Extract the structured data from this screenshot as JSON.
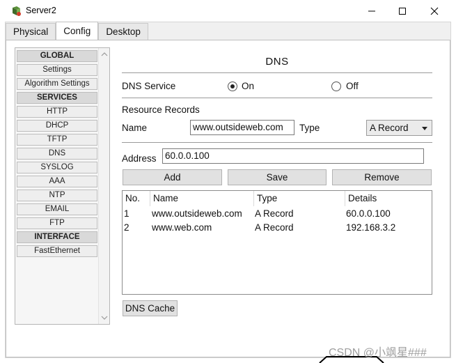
{
  "window": {
    "title": "Server2"
  },
  "tabs": [
    {
      "label": "Physical",
      "active": false
    },
    {
      "label": "Config",
      "active": true
    },
    {
      "label": "Desktop",
      "active": false
    }
  ],
  "sidebar": {
    "items": [
      {
        "label": "GLOBAL",
        "header": true
      },
      {
        "label": "Settings",
        "header": false
      },
      {
        "label": "Algorithm Settings",
        "header": false
      },
      {
        "label": "SERVICES",
        "header": true
      },
      {
        "label": "HTTP",
        "header": false
      },
      {
        "label": "DHCP",
        "header": false
      },
      {
        "label": "TFTP",
        "header": false
      },
      {
        "label": "DNS",
        "header": false
      },
      {
        "label": "SYSLOG",
        "header": false
      },
      {
        "label": "AAA",
        "header": false
      },
      {
        "label": "NTP",
        "header": false
      },
      {
        "label": "EMAIL",
        "header": false
      },
      {
        "label": "FTP",
        "header": false
      },
      {
        "label": "INTERFACE",
        "header": true
      },
      {
        "label": "FastEthernet",
        "header": false
      }
    ]
  },
  "dns": {
    "title": "DNS",
    "service_label": "DNS Service",
    "on_label": "On",
    "off_label": "Off",
    "service_state": "On",
    "resource_records_label": "Resource Records",
    "name_label": "Name",
    "name_value": "www.outsideweb.com",
    "type_label": "Type",
    "type_value": "A Record",
    "address_label": "Address",
    "address_value": "60.0.0.100",
    "add_label": "Add",
    "save_label": "Save",
    "remove_label": "Remove",
    "cache_label": "DNS Cache"
  },
  "records": {
    "columns": [
      "No.",
      "Name",
      "Type",
      "Details"
    ],
    "rows": [
      [
        "1",
        "www.outsideweb.com",
        "A Record",
        "60.0.0.100"
      ],
      [
        "2",
        "www.web.com",
        "A Record",
        "192.168.3.2"
      ]
    ]
  },
  "watermark": "CSDN @小飒星###",
  "colors": {
    "panel_bg": "#f0f0f0",
    "content_bg": "#ffffff",
    "header_item_bg": "#d9d9d9"
  }
}
